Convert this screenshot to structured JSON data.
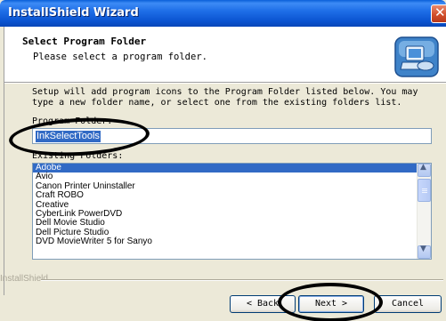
{
  "window": {
    "title": "InstallShield Wizard",
    "close_glyph": "✕"
  },
  "header": {
    "title": "Select Program Folder",
    "subtitle": "Please select a program folder.",
    "icon": "computer-install-icon"
  },
  "body": {
    "description": "Setup will add program icons to the Program Folder listed below.  You may type a new folder name, or select one from the existing folders list.",
    "program_folder_label": "Program Folder:",
    "program_folder_value": "InkSelectTools",
    "existing_folders_label": "Existing Folders:",
    "existing_folders": [
      "Adobe",
      "Avio",
      "Canon Printer Uninstaller",
      "Craft ROBO",
      "Creative",
      "CyberLink PowerDVD",
      "Dell Movie Studio",
      "Dell Picture Studio",
      "DVD MovieWriter 5 for Sanyo"
    ],
    "selected_folder": "Adobe"
  },
  "footer": {
    "brand": "InstallShield",
    "back_label": "< Back",
    "next_label": "Next >",
    "cancel_label": "Cancel"
  },
  "colors": {
    "title_bar": "#0a53d0",
    "selection": "#316ac5",
    "dialog_bg": "#ece9d8"
  }
}
